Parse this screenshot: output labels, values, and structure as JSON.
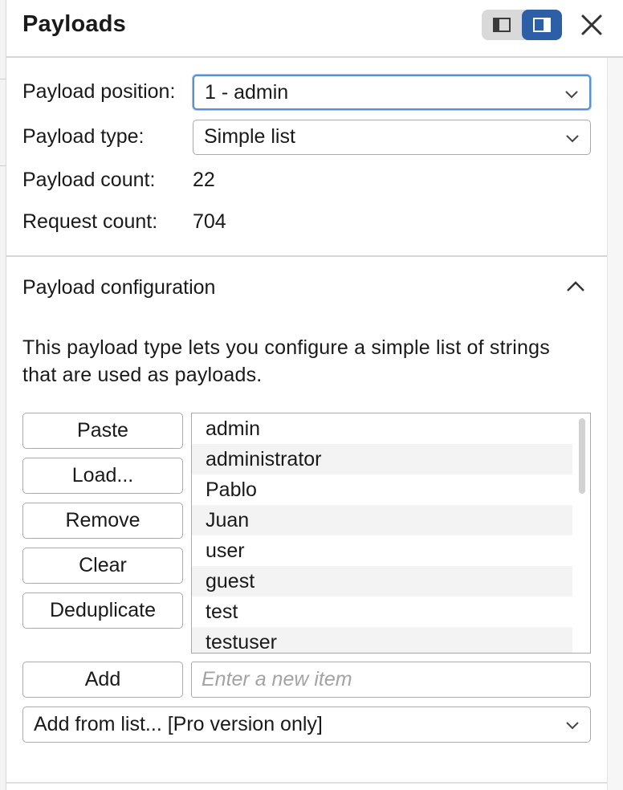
{
  "panel": {
    "title": "Payloads",
    "view_toggle": {
      "options": [
        "split-left-icon",
        "split-right-icon"
      ],
      "active_index": 1
    }
  },
  "fields": {
    "position_label": "Payload position:",
    "position_value": "1 - admin",
    "type_label": "Payload type:",
    "type_value": "Simple list",
    "count_label": "Payload count:",
    "count_value": "22",
    "request_label": "Request count:",
    "request_value": "704"
  },
  "config": {
    "title": "Payload configuration",
    "description": "This payload type lets you configure a simple list of strings that are used as payloads.",
    "buttons": {
      "paste": "Paste",
      "load": "Load...",
      "remove": "Remove",
      "clear": "Clear",
      "deduplicate": "Deduplicate",
      "add": "Add"
    },
    "items": [
      "admin",
      "administrator",
      "Pablo",
      "Juan",
      "user",
      "guest",
      "test",
      "testuser"
    ],
    "new_item_placeholder": "Enter a new item",
    "add_from_list": "Add from list... [Pro version only]"
  },
  "colors": {
    "accent": "#2d5fa6",
    "focus": "#5a8fd0",
    "border": "#a9a9a9"
  }
}
